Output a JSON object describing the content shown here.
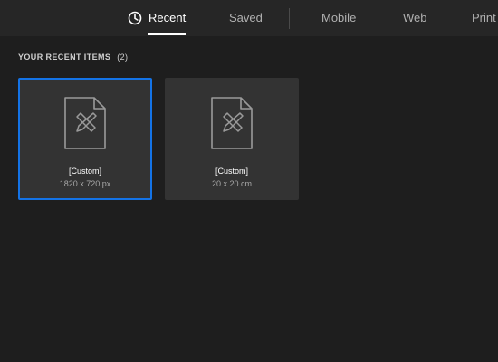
{
  "tabs": [
    {
      "label": "Recent",
      "active": true,
      "icon": "clock-icon"
    },
    {
      "label": "Saved"
    },
    {
      "label": "Mobile"
    },
    {
      "label": "Web"
    },
    {
      "label": "Print"
    }
  ],
  "section": {
    "title": "YOUR RECENT ITEMS",
    "count": "(2)"
  },
  "recent_items": [
    {
      "name": "[Custom]",
      "size": "1820 x 720 px",
      "selected": true,
      "icon": "document-design-icon"
    },
    {
      "name": "[Custom]",
      "size": "20 x 20 cm",
      "selected": false,
      "icon": "document-design-icon"
    }
  ],
  "colors": {
    "background": "#1e1e1e",
    "topbar": "#262626",
    "card": "#333333",
    "selection": "#1473e6"
  }
}
